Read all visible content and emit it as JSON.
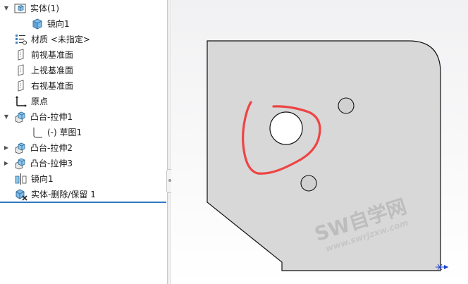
{
  "tree": {
    "items": [
      {
        "label": "实体(1)",
        "icon": "solid-bodies-folder-icon",
        "expander": "▼"
      },
      {
        "label": "镜向1",
        "icon": "body-cube-icon",
        "expander": ""
      },
      {
        "label": "材质 <未指定>",
        "icon": "material-icon",
        "expander": ""
      },
      {
        "label": "前视基准面",
        "icon": "plane-icon",
        "expander": ""
      },
      {
        "label": "上视基准面",
        "icon": "plane-icon",
        "expander": ""
      },
      {
        "label": "右视基准面",
        "icon": "plane-icon",
        "expander": ""
      },
      {
        "label": "原点",
        "icon": "origin-icon",
        "expander": ""
      },
      {
        "label": "凸台-拉伸1",
        "icon": "boss-extrude-icon",
        "expander": "▼"
      },
      {
        "label": "(-) 草图1",
        "icon": "sketch-icon",
        "expander": ""
      },
      {
        "label": "凸台-拉伸2",
        "icon": "boss-extrude-icon",
        "expander": "▶"
      },
      {
        "label": "凸台-拉伸3",
        "icon": "boss-extrude-icon",
        "expander": "▶"
      },
      {
        "label": "镜向1",
        "icon": "mirror-icon",
        "expander": ""
      },
      {
        "label": "实体-删除/保留 1",
        "icon": "delete-body-icon",
        "expander": ""
      }
    ]
  },
  "watermark": {
    "main": "SW自学网",
    "url": "www.swrjzxw.com"
  },
  "colors": {
    "part_face": "#d8d8d8",
    "part_edge": "#111111",
    "annotation": "#ee4444",
    "selection_line": "#2f79c2",
    "watermark": "#b9b9b9"
  }
}
